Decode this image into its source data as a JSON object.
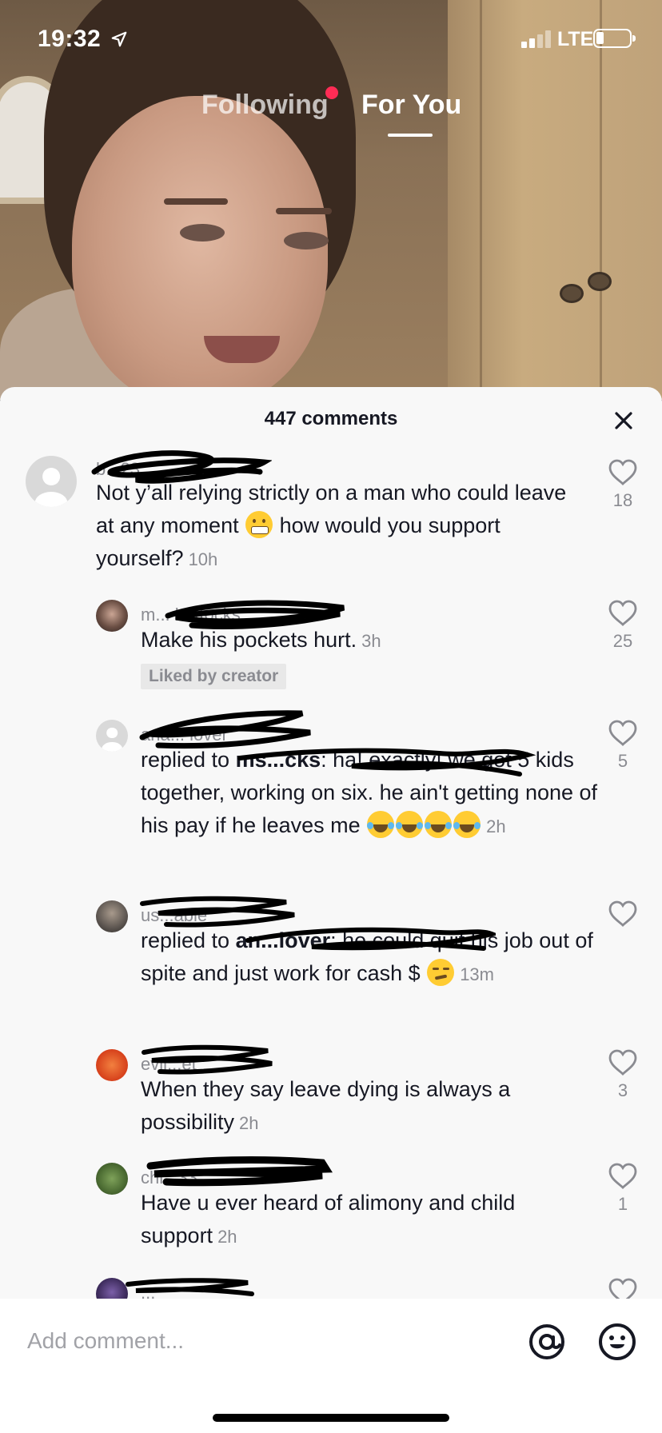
{
  "status_bar": {
    "time": "19:32",
    "network": "LTE"
  },
  "feed_tabs": {
    "following": "Following",
    "for_you": "For You"
  },
  "comments_panel": {
    "count_label": "447 comments",
    "comments": [
      {
        "username": "b...23",
        "body": "Not y’all relying strictly on a man who could leave at any moment",
        "body_after_emoji": " how would you support yourself?",
        "timestamp": "10h",
        "likes": "18"
      },
      {
        "username": "m... buttocks",
        "body": "Make his pockets hurt.",
        "timestamp": "3h",
        "likes": "25",
        "badge": "Liked by creator"
      },
      {
        "username": "ana... lover",
        "reply_prefix": "replied to ",
        "reply_target": "ms...cks",
        "body": ": ha! exactly! we got 5 kids together, working on six. he ain't getting none of his pay if he leaves me",
        "timestamp": "2h",
        "likes": "5"
      },
      {
        "username": "us...able",
        "reply_prefix": "replied to ",
        "reply_target": "an...lover",
        "body": ": he could quit his job out of spite and just work for cash $",
        "timestamp": "13m",
        "likes": ""
      },
      {
        "username": "evil...et",
        "body": "When they say leave dying is always a possibility",
        "timestamp": "2h",
        "likes": "3"
      },
      {
        "username": "chl...33",
        "body": "Have u ever heard of alimony and child support",
        "timestamp": "2h",
        "likes": "1"
      },
      {
        "username": "...",
        "body": "",
        "timestamp": "",
        "likes": ""
      }
    ]
  },
  "comment_input": {
    "placeholder": "Add comment..."
  },
  "icons": {
    "location": "location-arrow-icon",
    "close": "close-icon",
    "heart": "heart-icon",
    "mention": "at-sign-icon",
    "emoji": "emoji-icon"
  },
  "colors": {
    "accent_dot": "#fe2c55",
    "sheet_bg": "#f8f8f8",
    "text": "#161823",
    "muted": "#8a8b91"
  }
}
